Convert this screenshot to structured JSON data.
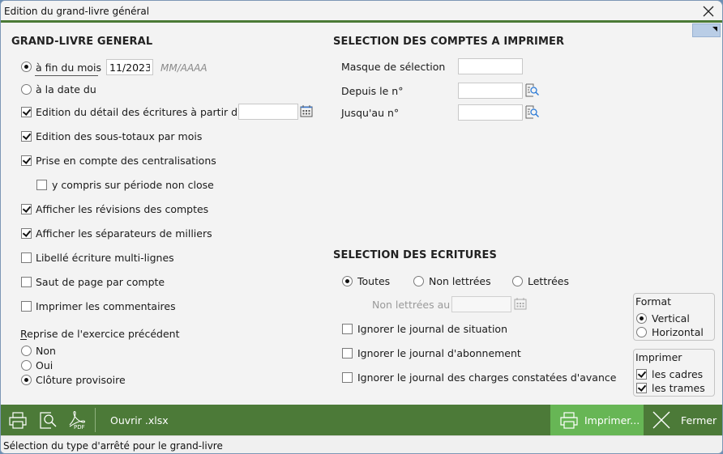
{
  "window": {
    "title": "Edition du grand-livre général"
  },
  "grand_livre": {
    "heading": "GRAND-LIVRE GENERAL",
    "period": {
      "options": [
        {
          "label": "à fin du mois",
          "selected": true
        },
        {
          "label": "à la date du",
          "selected": false
        }
      ],
      "month_value": "11/2023",
      "month_hint": "MM/AAAA"
    },
    "options": [
      {
        "label": "Edition du détail des écritures à partir du",
        "checked": true
      },
      {
        "label": "Edition des sous-totaux par mois",
        "checked": true
      },
      {
        "label": "Prise en compte des centralisations",
        "checked": true
      },
      {
        "label": "y compris sur période non close",
        "checked": false
      },
      {
        "label": "Afficher les révisions des comptes",
        "checked": true
      },
      {
        "label": "Afficher les séparateurs de milliers",
        "checked": true
      },
      {
        "label": "Libellé écriture multi-lignes",
        "checked": false
      },
      {
        "label": "Saut de page par compte",
        "checked": false
      },
      {
        "label": "Imprimer les commentaires",
        "checked": false
      }
    ],
    "detail_from_date": "",
    "reprise": {
      "label": "Reprise de l'exercice précédent",
      "options": [
        {
          "label": "Non",
          "selected": false
        },
        {
          "label": "Oui",
          "selected": false
        },
        {
          "label": "Clôture provisoire",
          "selected": true
        }
      ]
    }
  },
  "comptes": {
    "heading": "SELECTION DES COMPTES A IMPRIMER",
    "masque_label": "Masque de sélection",
    "masque_value": "",
    "depuis_label": "Depuis le n°",
    "depuis_value": "",
    "jusqua_label": "Jusqu'au n°",
    "jusqua_value": ""
  },
  "ecritures": {
    "heading": "SELECTION DES ECRITURES",
    "options": [
      {
        "label": "Toutes",
        "selected": true
      },
      {
        "label": "Non lettrées",
        "selected": false
      },
      {
        "label": "Lettrées",
        "selected": false
      }
    ],
    "non_lettrees_au_label": "Non lettrées au",
    "non_lettrees_au_value": "",
    "ignore": [
      {
        "label": "Ignorer le journal de situation",
        "checked": false
      },
      {
        "label": "Ignorer le journal d'abonnement",
        "checked": false
      },
      {
        "label": "Ignorer le journal des charges constatées d'avance",
        "checked": false
      }
    ]
  },
  "format": {
    "title": "Format",
    "options": [
      {
        "label": "Vertical",
        "selected": true
      },
      {
        "label": "Horizontal",
        "selected": false
      }
    ]
  },
  "imprimer": {
    "title": "Imprimer",
    "options": [
      {
        "label": "les cadres",
        "checked": true
      },
      {
        "label": "les trames",
        "checked": true
      }
    ]
  },
  "toolbar": {
    "open_xlsx": "Ouvrir .xlsx",
    "print": "Imprimer...",
    "close": "Fermer"
  },
  "status": "Sélection du type d'arrêté pour le grand-livre",
  "colors": {
    "accent_green": "#4c7a38",
    "print_green": "#67b655"
  }
}
